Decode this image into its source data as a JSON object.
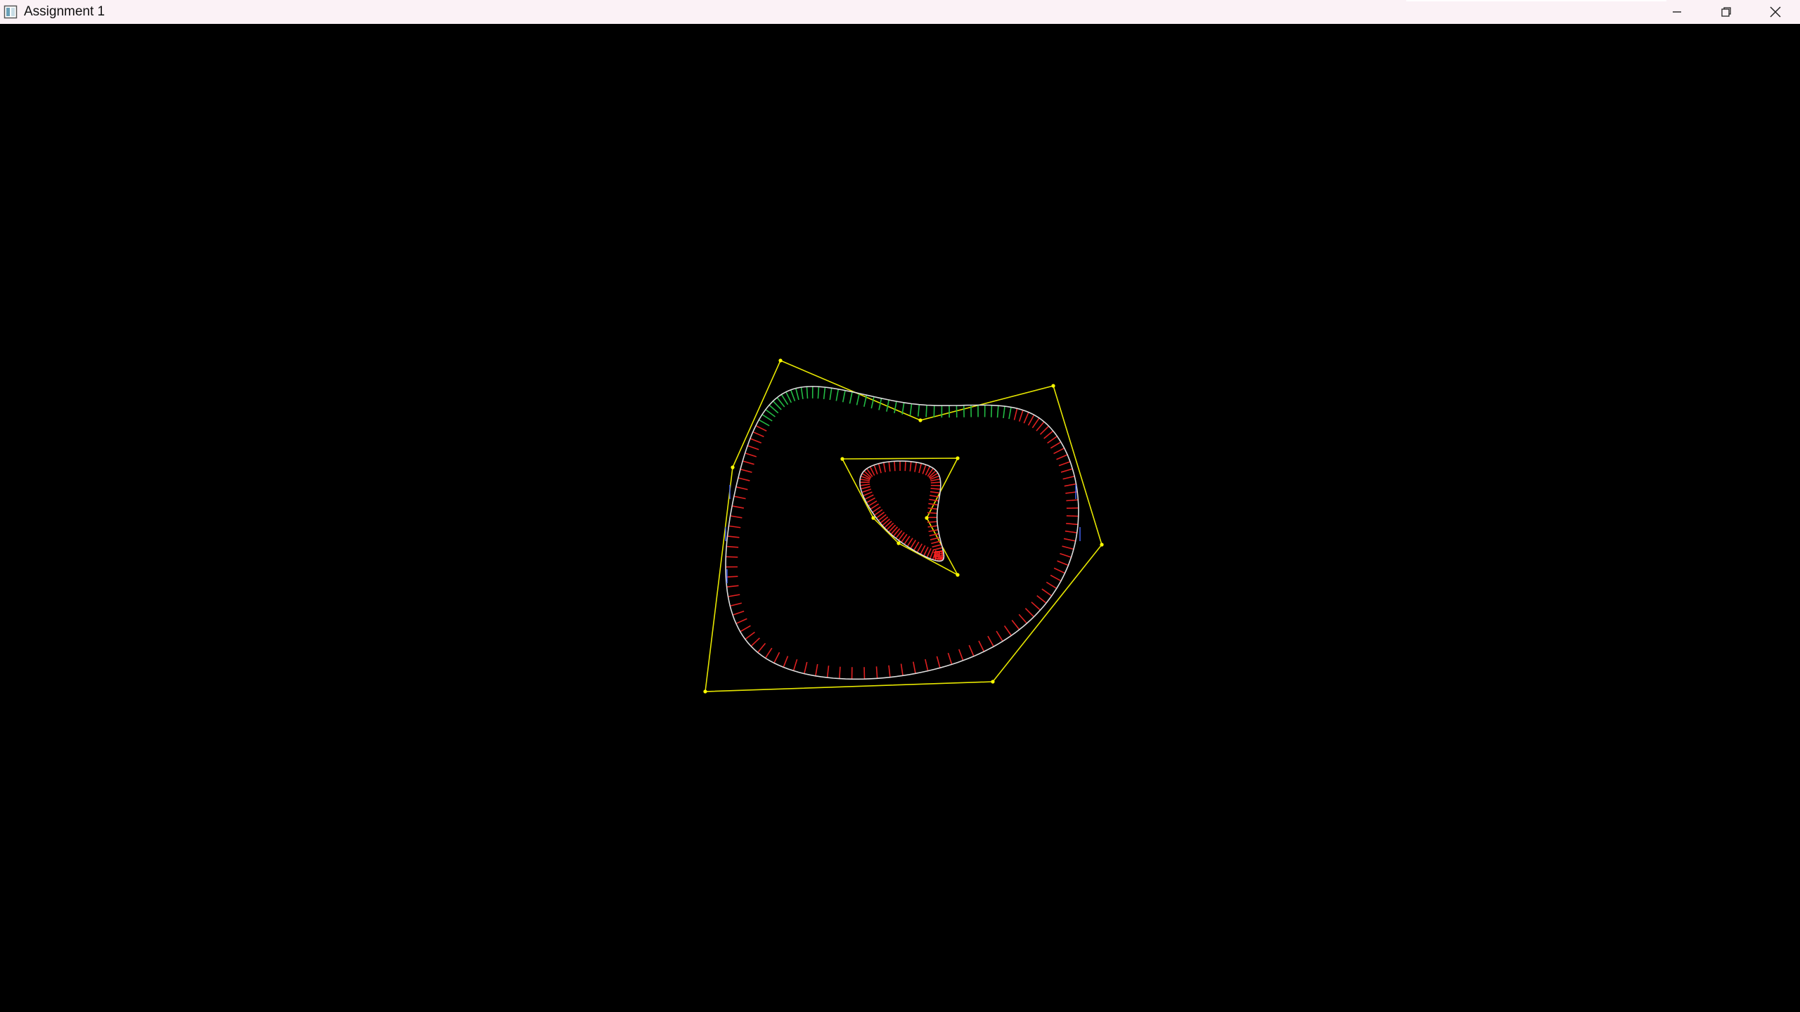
{
  "window": {
    "title": "Assignment 1",
    "app_icon": "window-app-icon",
    "controls": {
      "minimize_icon": "minimize-icon",
      "restore_icon": "restore-icon",
      "close_icon": "close-icon"
    }
  },
  "canvas": {
    "background": "#000000",
    "colors": {
      "control_polygon": "#e6e600",
      "control_point": "#ffff00",
      "curve": "#dddddd",
      "normal_inner": "#e02020",
      "normal_outer_top": "#22bb44",
      "normal_outer_side": "#4466ff",
      "selected_point": "#ff2020"
    }
  }
}
